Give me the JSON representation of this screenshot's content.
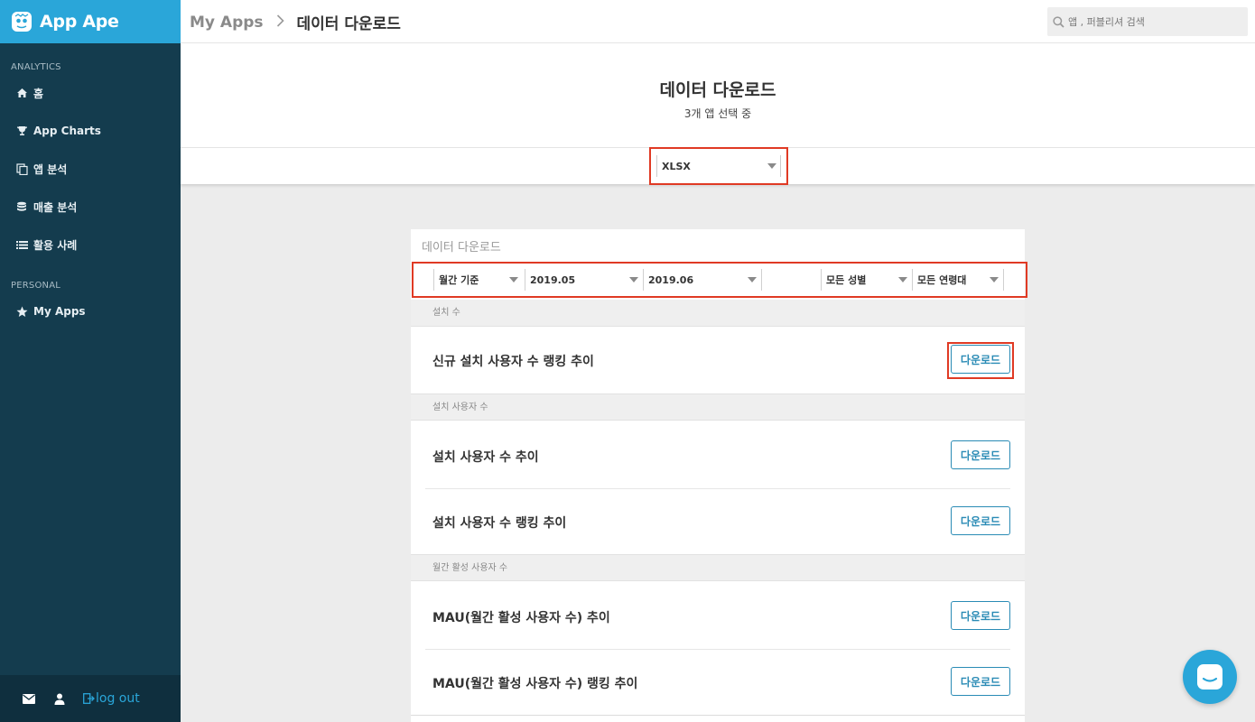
{
  "brand": {
    "name": "App Ape"
  },
  "sidebar": {
    "section_analytics": "ANALYTICS",
    "section_personal": "PERSONAL",
    "items": [
      {
        "label": "홈",
        "icon": "home-icon"
      },
      {
        "label": "App Charts",
        "icon": "trophy-icon"
      },
      {
        "label": "앱 분석",
        "icon": "copy-icon"
      },
      {
        "label": "매출 분석",
        "icon": "database-icon"
      },
      {
        "label": "활용 사례",
        "icon": "list-icon"
      },
      {
        "label": "My Apps",
        "icon": "star-icon"
      }
    ],
    "footer": {
      "logout_label": "log out"
    }
  },
  "header": {
    "breadcrumb_root": "My Apps",
    "breadcrumb_sep": ">",
    "breadcrumb_current": "데이터 다운로드",
    "search_placeholder": "앱 , 퍼블리셔 검색"
  },
  "page": {
    "title": "데이터 다운로드",
    "subtitle": "3개 앱 선택 중",
    "format_selected": "XLSX"
  },
  "card": {
    "title": "데이터 다운로드",
    "filters": {
      "period": "월간 기준",
      "start": "2019.05",
      "end": "2019.06",
      "gender": "모든 성별",
      "age": "모든 연령대"
    },
    "download_label": "다운로드",
    "sections": [
      {
        "header": "설치 수",
        "rows": [
          "신규 설치 사용자 수 랭킹 추이"
        ]
      },
      {
        "header": "설치 사용자 수",
        "rows": [
          "설치 사용자 수 추이",
          "설치 사용자 수 랭킹 추이"
        ]
      },
      {
        "header": "월간 활성 사용자 수",
        "rows": [
          "MAU(월간 활성 사용자 수) 추이",
          "MAU(월간 활성 사용자 수) 랭킹 추이"
        ]
      }
    ]
  },
  "colors": {
    "accent": "#2aa6d9",
    "sidebar_bg": "#143c4e",
    "highlight": "#e03a24"
  }
}
